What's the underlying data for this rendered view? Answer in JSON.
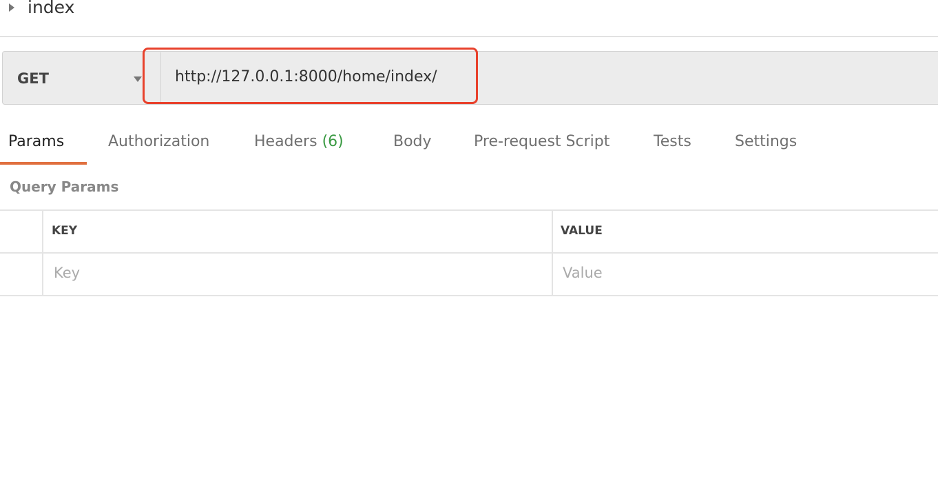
{
  "request": {
    "name": "index",
    "method": "GET",
    "url": "http://127.0.0.1:8000/home/index/"
  },
  "tabs": [
    {
      "label": "Params",
      "active": true
    },
    {
      "label": "Authorization"
    },
    {
      "label": "Headers",
      "count": "(6)"
    },
    {
      "label": "Body"
    },
    {
      "label": "Pre-request Script"
    },
    {
      "label": "Tests"
    },
    {
      "label": "Settings"
    }
  ],
  "query_params": {
    "title": "Query Params",
    "columns": [
      "KEY",
      "VALUE"
    ],
    "placeholders": {
      "key": "Key",
      "value": "Value"
    }
  },
  "colors": {
    "accent": "#e0703f",
    "highlight": "#e8412c",
    "count": "#3a9a43"
  }
}
